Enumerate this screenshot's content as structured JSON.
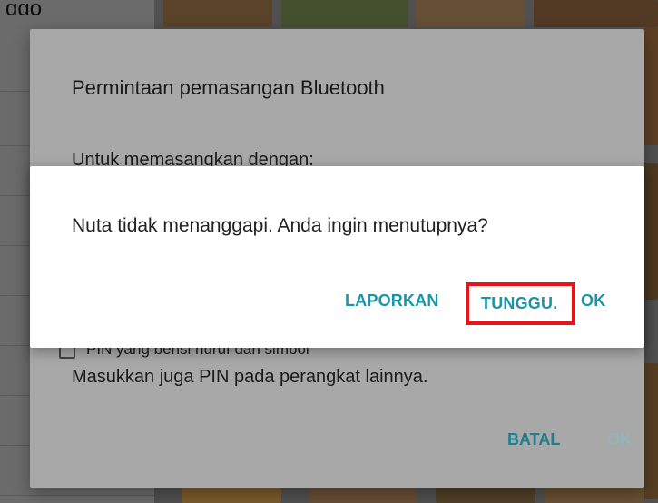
{
  "background": {
    "left_top_text": "ggo"
  },
  "bluetooth_dialog": {
    "title": "Permintaan pemasangan Bluetooth",
    "subtitle": "Untuk memasangkan dengan:",
    "checkbox_label": "PIN yang berisi huruf dan simbol",
    "hint": "Masukkan juga PIN pada perangkat lainnya.",
    "cancel_label": "BATAL",
    "ok_label": "OK"
  },
  "anr_dialog": {
    "message": "Nuta tidak menanggapi. Anda ingin menutupnya?",
    "report_label": "LAPORKAN",
    "wait_label": "TUNGGU.",
    "ok_label": "OK"
  },
  "colors": {
    "accent": "#1a95a8",
    "highlight_box": "#e8141c"
  }
}
